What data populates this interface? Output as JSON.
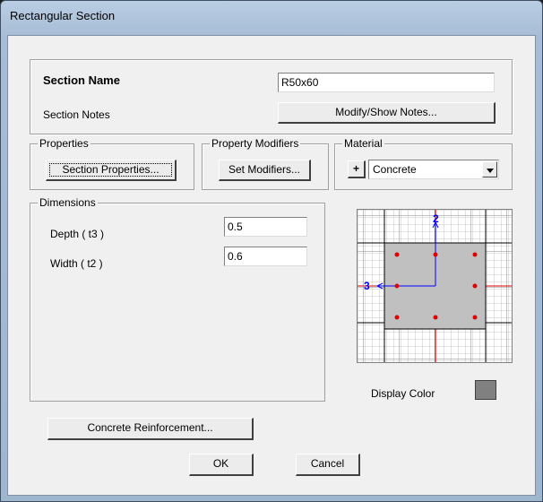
{
  "window": {
    "title": "Rectangular Section"
  },
  "section": {
    "name_label": "Section Name",
    "name_value": "R50x60",
    "notes_label": "Section Notes",
    "notes_button": "Modify/Show Notes..."
  },
  "properties": {
    "legend": "Properties",
    "button": "Section Properties..."
  },
  "modifiers": {
    "legend": "Property Modifiers",
    "button": "Set Modifiers..."
  },
  "material": {
    "legend": "Material",
    "plus": "+",
    "selected": "Concrete"
  },
  "dimensions": {
    "legend": "Dimensions",
    "depth_label": "Depth  ( t3 )",
    "depth_value": "0.5",
    "width_label": "Width  ( t2 )",
    "width_value": "0.6"
  },
  "preview": {
    "axis_2": "2",
    "axis_3": "3",
    "display_color_label": "Display Color",
    "display_color": "#808080",
    "rebar_color": "#e00000"
  },
  "buttons": {
    "reinforcement": "Concrete Reinforcement...",
    "ok": "OK",
    "cancel": "Cancel"
  }
}
